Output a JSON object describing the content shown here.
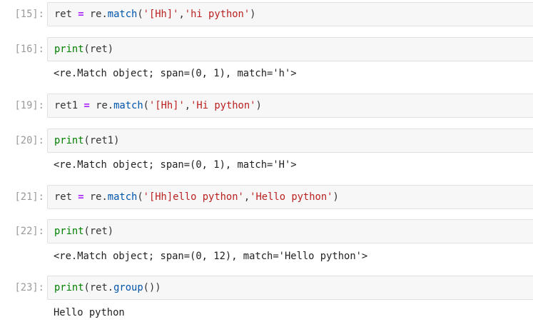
{
  "cells": [
    {
      "prompt": "[15]:",
      "code": {
        "a": "ret",
        "op": "=",
        "b": "re.",
        "fn": "match",
        "c": "(",
        "s1": "'[Hh]'",
        "comma": ",",
        "s2": "'hi python'",
        "d": ")"
      },
      "output": null
    },
    {
      "prompt": "[16]:",
      "code": {
        "print": "print",
        "arg": "(ret)"
      },
      "output": "<re.Match object; span=(0, 1), match='h'>"
    },
    {
      "prompt": "[19]:",
      "code": {
        "a": "ret1",
        "op": "=",
        "b": "re.",
        "fn": "match",
        "c": "(",
        "s1": "'[Hh]'",
        "comma": ",",
        "s2": "'Hi python'",
        "d": ")"
      },
      "output": null
    },
    {
      "prompt": "[20]:",
      "code": {
        "print": "print",
        "arg": "(ret1)"
      },
      "output": "<re.Match object; span=(0, 1), match='H'>"
    },
    {
      "prompt": "[21]:",
      "code": {
        "a": "ret",
        "op": "=",
        "b": "re.",
        "fn": "match",
        "c": "(",
        "s1": "'[Hh]ello python'",
        "comma": ",",
        "s2": "'Hello python'",
        "d": ")"
      },
      "output": null
    },
    {
      "prompt": "[22]:",
      "code": {
        "print": "print",
        "arg": "(ret)"
      },
      "output": "<re.Match object; span=(0, 12), match='Hello python'>"
    },
    {
      "prompt": "[23]:",
      "code": {
        "print": "print",
        "p1": "(ret.",
        "fn": "group",
        "p2": "())"
      },
      "output": "Hello python"
    }
  ],
  "colors": {
    "prompt": "#9a9a9a",
    "input_bg": "#f7f7f7",
    "input_border": "#e0e0e0",
    "keyword_print": "#008000",
    "operator": "#aa22ff",
    "function": "#0055aa",
    "string": "#ba2121"
  }
}
